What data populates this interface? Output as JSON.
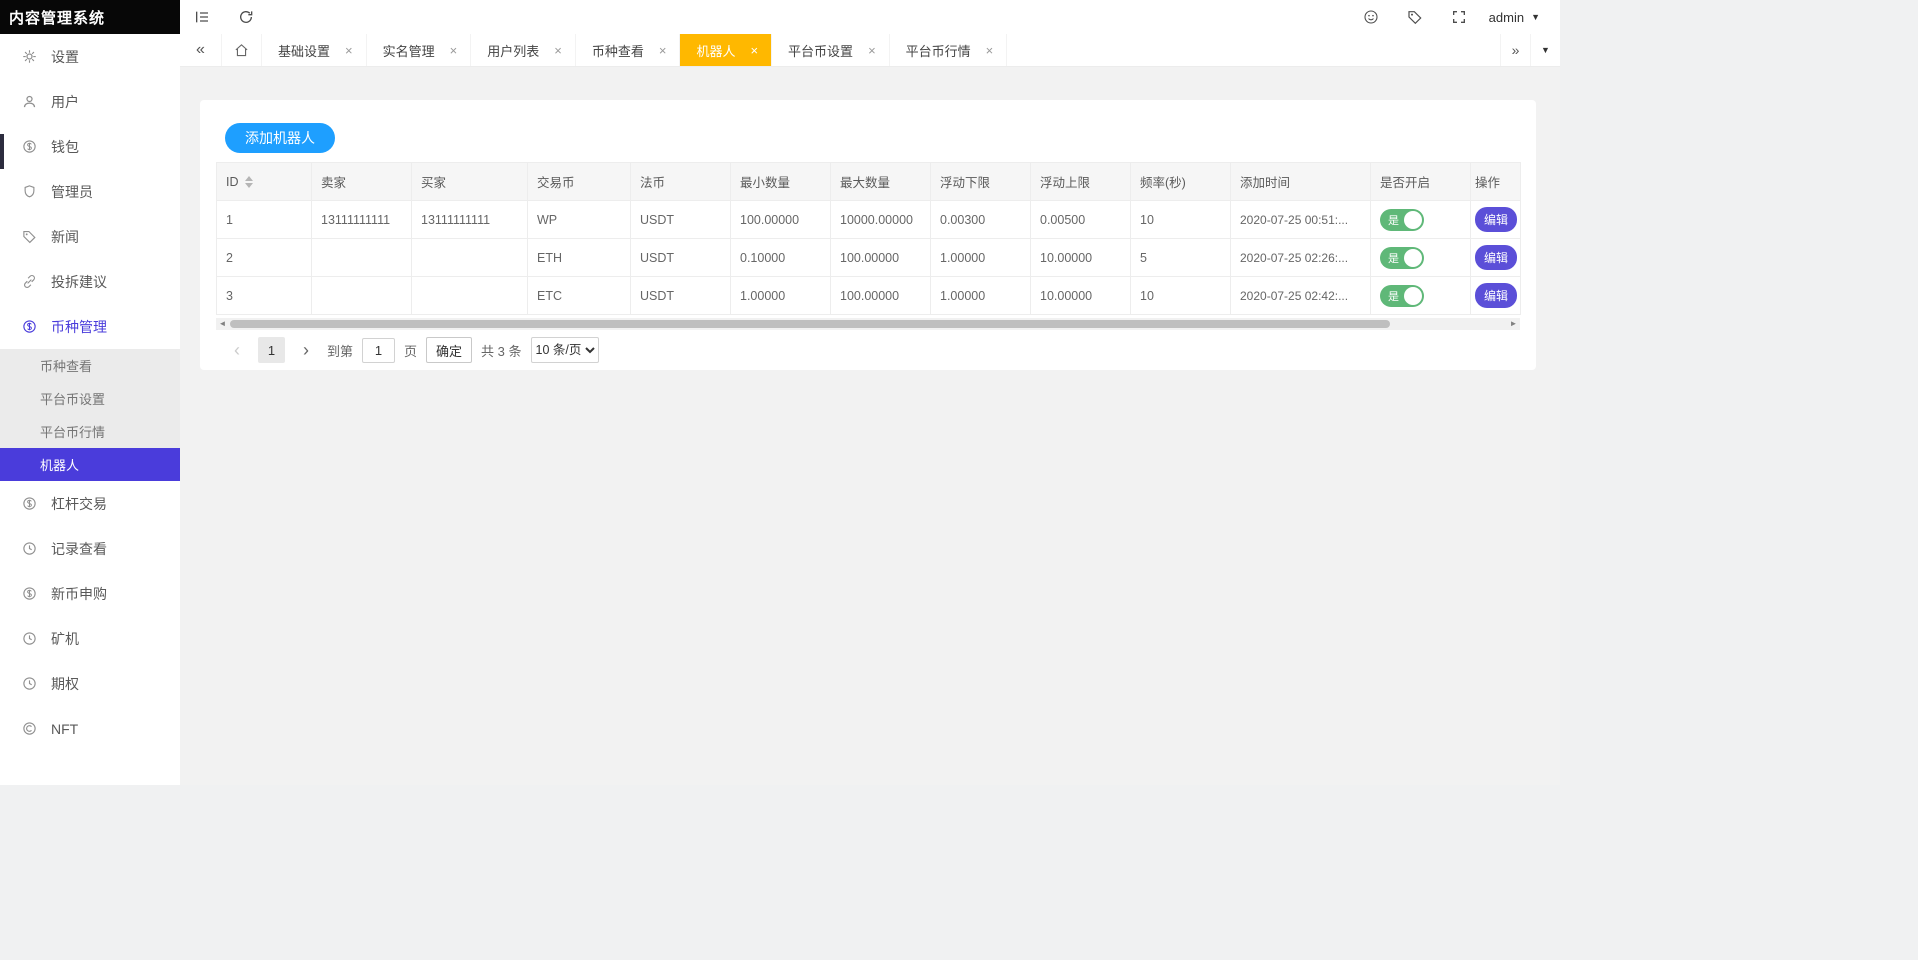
{
  "app": {
    "title": "内容管理系统"
  },
  "topbar": {
    "left_icons": [
      "collapse-menu-icon",
      "refresh-icon"
    ],
    "right_icons": [
      "theme-icon",
      "tag-icon",
      "fullscreen-icon"
    ],
    "user": {
      "name": "admin"
    }
  },
  "tabbar": {
    "tabs": [
      {
        "label": "基础设置",
        "active": false
      },
      {
        "label": "实名管理",
        "active": false
      },
      {
        "label": "用户列表",
        "active": false
      },
      {
        "label": "币种查看",
        "active": false
      },
      {
        "label": "机器人",
        "active": true
      },
      {
        "label": "平台币设置",
        "active": false
      },
      {
        "label": "平台币行情",
        "active": false
      }
    ],
    "close_glyph": "×"
  },
  "sidebar": {
    "items": [
      {
        "label": "设置",
        "icon": "gear-icon"
      },
      {
        "label": "用户",
        "icon": "user-icon"
      },
      {
        "label": "钱包",
        "icon": "wallet-icon"
      },
      {
        "label": "管理员",
        "icon": "shield-icon"
      },
      {
        "label": "新闻",
        "icon": "tag-icon"
      },
      {
        "label": "投拆建议",
        "icon": "link-icon"
      },
      {
        "label": "币种管理",
        "icon": "coin-icon",
        "expanded": true
      },
      {
        "label": "杠杆交易",
        "icon": "coin-icon"
      },
      {
        "label": "记录查看",
        "icon": "clock-icon"
      },
      {
        "label": "新币申购",
        "icon": "coin-icon"
      },
      {
        "label": "矿机",
        "icon": "clock-icon"
      },
      {
        "label": "期权",
        "icon": "clock-icon"
      },
      {
        "label": "NFT",
        "icon": "circle-icon"
      }
    ],
    "coin_submenu": [
      {
        "label": "币种查看",
        "active": false
      },
      {
        "label": "平台币设置",
        "active": false
      },
      {
        "label": "平台币行情",
        "active": false
      },
      {
        "label": "机器人",
        "active": true
      }
    ]
  },
  "content": {
    "add_button": "添加机器人",
    "table": {
      "columns": [
        "ID",
        "卖家",
        "买家",
        "交易币",
        "法币",
        "最小数量",
        "最大数量",
        "浮动下限",
        "浮动上限",
        "频率(秒)",
        "添加时间",
        "是否开启",
        "操作"
      ],
      "rows": [
        {
          "id": "1",
          "seller": "13111111111",
          "buyer": "13111111111",
          "coin": "WP",
          "fiat": "USDT",
          "min": "100.00000",
          "max": "10000.00000",
          "float_min": "0.00300",
          "float_max": "0.00500",
          "freq": "10",
          "time": "2020-07-25 00:51:...",
          "enabled_label": "是",
          "action_label": "编辑"
        },
        {
          "id": "2",
          "seller": "",
          "buyer": "",
          "coin": "ETH",
          "fiat": "USDT",
          "min": "0.10000",
          "max": "100.00000",
          "float_min": "1.00000",
          "float_max": "10.00000",
          "freq": "5",
          "time": "2020-07-25 02:26:...",
          "enabled_label": "是",
          "action_label": "编辑"
        },
        {
          "id": "3",
          "seller": "",
          "buyer": "",
          "coin": "ETC",
          "fiat": "USDT",
          "min": "1.00000",
          "max": "100.00000",
          "float_min": "1.00000",
          "float_max": "10.00000",
          "freq": "10",
          "time": "2020-07-25 02:42:...",
          "enabled_label": "是",
          "action_label": "编辑"
        }
      ]
    },
    "pagination": {
      "current_page": "1",
      "goto_label": "到第",
      "goto_value": "1",
      "page_unit": "页",
      "confirm_label": "确定",
      "total_label": "共 3 条",
      "page_size_label": "10 条/页"
    }
  },
  "colors": {
    "accent_purple": "#4a3cdb",
    "tab_active_yellow": "#ffb800",
    "add_button_blue": "#1e9fff",
    "toggle_green": "#5fb878",
    "logo_bg": "#070707"
  }
}
